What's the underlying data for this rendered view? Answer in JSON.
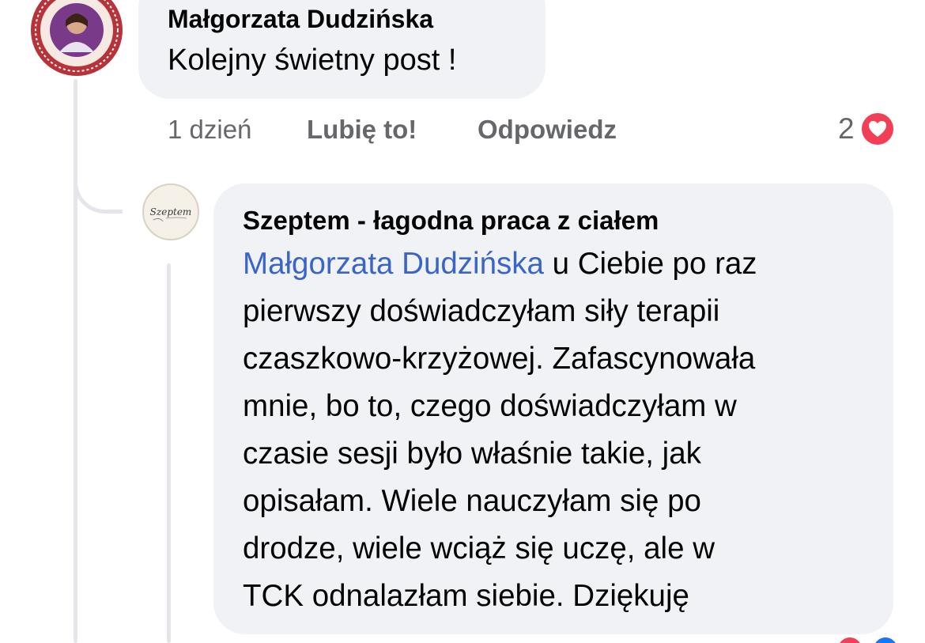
{
  "comment": {
    "author": "Małgorzata Dudzińska",
    "text": "Kolejny świetny post !",
    "avatar_icon": "seal-portrait-avatar",
    "time": "1 dzień",
    "like_label": "Lubię to!",
    "reply_label": "Odpowiedz",
    "reaction_count": "2",
    "reaction_icon": "heart-icon",
    "reaction_color": "#f33e58"
  },
  "reply": {
    "author": "Szeptem - łagodna praca z ciałem",
    "avatar_icon": "szeptem-logo-avatar",
    "mention": "Małgorzata Dudzińska",
    "mention_color": "#3a65c7",
    "first_line_rest": " u Ciebie po raz",
    "lines": [
      "pierwszy doświadczyłam siły terapii",
      "czaszkowo-krzyżowej. Zafascynowała",
      "mnie, bo to, czego doświadczyłam w",
      "czasie sesji było właśnie takie, jak",
      "opisałam. Wiele nauczyłam się po",
      "drodze, wiele wciąż się uczę, ale w",
      "TCK odnalazłam siebie. Dziękuję"
    ]
  },
  "colors": {
    "bubble": "#f0f2f5",
    "secondary_text": "#65676b",
    "thread_line": "#e4e6eb"
  }
}
